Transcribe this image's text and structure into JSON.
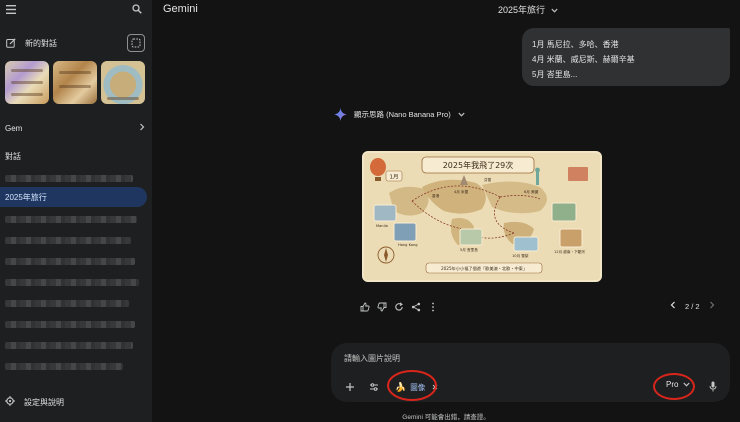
{
  "sidebar": {
    "new_chat_label": "新的對話",
    "gem_label": "Gem",
    "conversations_heading": "對話",
    "active_conversation": "2025年旅行",
    "settings_label": "設定與說明"
  },
  "header": {
    "app_title": "Gemini",
    "chat_title": "2025年旅行"
  },
  "conversation": {
    "user_message_lines": [
      "1月 馬尼拉、多哈、香港",
      "4月 米蘭、威尼斯、赫爾辛基",
      "5月 峇里島..."
    ],
    "model_status": "顯示思路 (Nano Banana Pro)",
    "image": {
      "title_banner": "2025年我飛了29次",
      "footer_banner": "2025年小小福了個遊「歐美澳・北歐・中東」",
      "month_badge": "1月",
      "place_labels": [
        "Manila",
        "Hong Kong",
        "香港",
        "5月 峇里島",
        "4月 米蘭",
        "芬蘭",
        "6月 美國",
        "10月 雪梨",
        "12月 越南・下龍灣"
      ]
    },
    "pager": "2 / 2"
  },
  "input": {
    "placeholder": "請輸入圖片說明",
    "chip_label": "圖像",
    "mode_label": "Pro"
  },
  "footer": {
    "disclaimer": "Gemini 可能會出錯，請查證。"
  },
  "colors": {
    "background": "#131314",
    "sidebar": "#1e1f20",
    "active_item": "#1f3760",
    "accent_blue": "#a8c7fa",
    "annotation_red": "#d9261c"
  },
  "icons": {
    "menu": "menu-icon",
    "search": "search-icon",
    "new_chat": "edit-icon",
    "temporary_chat": "temporary-chat-icon",
    "settings": "gear-icon",
    "sparkle": "gemini-sparkle-icon",
    "like": "thumb-up-icon",
    "dislike": "thumb-down-icon",
    "regenerate": "refresh-icon",
    "share": "share-icon",
    "more": "more-vert-icon",
    "add": "plus-icon",
    "tools": "tune-icon",
    "mic": "mic-icon"
  }
}
